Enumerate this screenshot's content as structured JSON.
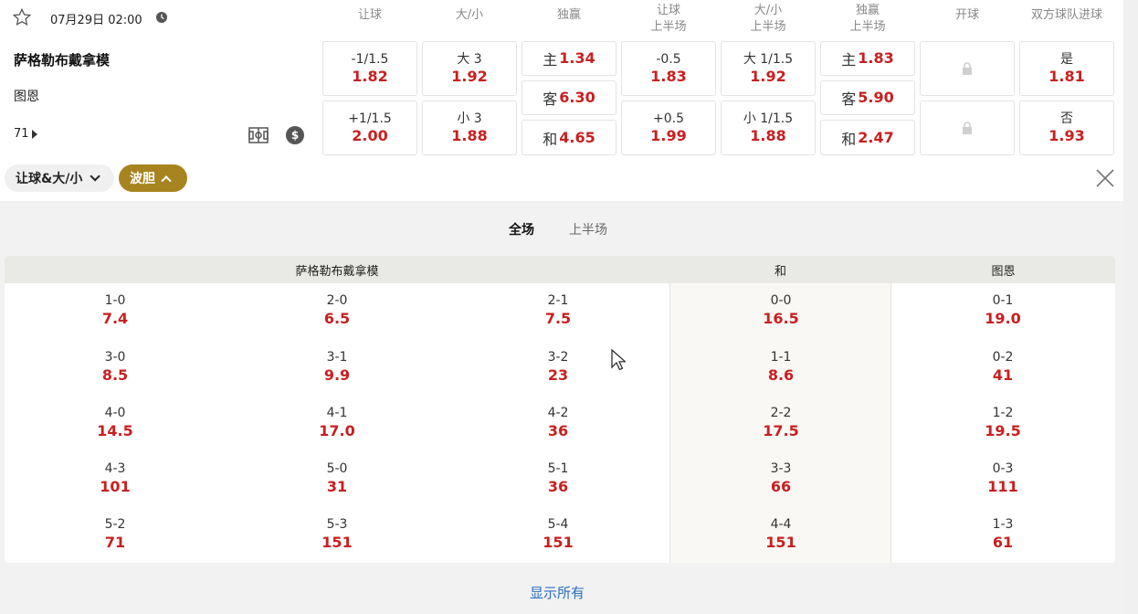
{
  "match": {
    "datetime": "07月29日 02:00",
    "home": "萨格勒布戴拿模",
    "away": "图恩",
    "more_count": "71"
  },
  "columns": [
    "让球",
    "大/小",
    "独赢",
    "让球\n上半场",
    "大/小\n上半场",
    "独赢\n上半场",
    "开球",
    "双方球队进球"
  ],
  "markets": {
    "handicap": [
      {
        "line": "-1/1.5",
        "odds": "1.82"
      },
      {
        "line": "+1/1.5",
        "odds": "2.00"
      }
    ],
    "total": [
      {
        "line": "大 3",
        "odds": "1.92"
      },
      {
        "line": "小 3",
        "odds": "1.88"
      }
    ],
    "moneyline": [
      {
        "label": "主",
        "odds": "1.34"
      },
      {
        "label": "客",
        "odds": "6.30"
      },
      {
        "label": "和",
        "odds": "4.65"
      }
    ],
    "handicap_1h": [
      {
        "line": "-0.5",
        "odds": "1.83"
      },
      {
        "line": "+0.5",
        "odds": "1.99"
      }
    ],
    "total_1h": [
      {
        "line": "大 1/1.5",
        "odds": "1.92"
      },
      {
        "line": "小 1/1.5",
        "odds": "1.88"
      }
    ],
    "moneyline_1h": [
      {
        "label": "主",
        "odds": "1.83"
      },
      {
        "label": "客",
        "odds": "5.90"
      },
      {
        "label": "和",
        "odds": "2.47"
      }
    ],
    "btts": [
      {
        "line": "是",
        "odds": "1.81"
      },
      {
        "line": "否",
        "odds": "1.93"
      }
    ]
  },
  "filters": {
    "handicap_total": "让球&大/小",
    "correct_score": "波胆"
  },
  "tabs": {
    "full": "全场",
    "first_half": "上半场"
  },
  "score_grid": {
    "headers": {
      "home": "萨格勒布戴拿模",
      "draw": "和",
      "away": "图恩"
    },
    "home_cols": [
      [
        {
          "s": "1-0",
          "o": "7.4"
        },
        {
          "s": "3-0",
          "o": "8.5"
        },
        {
          "s": "4-0",
          "o": "14.5"
        },
        {
          "s": "4-3",
          "o": "101"
        },
        {
          "s": "5-2",
          "o": "71"
        }
      ],
      [
        {
          "s": "2-0",
          "o": "6.5"
        },
        {
          "s": "3-1",
          "o": "9.9"
        },
        {
          "s": "4-1",
          "o": "17.0"
        },
        {
          "s": "5-0",
          "o": "31"
        },
        {
          "s": "5-3",
          "o": "151"
        }
      ],
      [
        {
          "s": "2-1",
          "o": "7.5"
        },
        {
          "s": "3-2",
          "o": "23"
        },
        {
          "s": "4-2",
          "o": "36"
        },
        {
          "s": "5-1",
          "o": "36"
        },
        {
          "s": "5-4",
          "o": "151"
        }
      ]
    ],
    "draw_col": [
      {
        "s": "0-0",
        "o": "16.5"
      },
      {
        "s": "1-1",
        "o": "8.6"
      },
      {
        "s": "2-2",
        "o": "17.5"
      },
      {
        "s": "3-3",
        "o": "66"
      },
      {
        "s": "4-4",
        "o": "151"
      }
    ],
    "away_col": [
      {
        "s": "0-1",
        "o": "19.0"
      },
      {
        "s": "0-2",
        "o": "41"
      },
      {
        "s": "1-2",
        "o": "19.5"
      },
      {
        "s": "0-3",
        "o": "111"
      },
      {
        "s": "1-3",
        "o": "61"
      }
    ]
  },
  "show_all": "显示所有",
  "colors": {
    "odds": "#c8201f",
    "accent": "#a88420",
    "link": "#2a6fbf"
  }
}
